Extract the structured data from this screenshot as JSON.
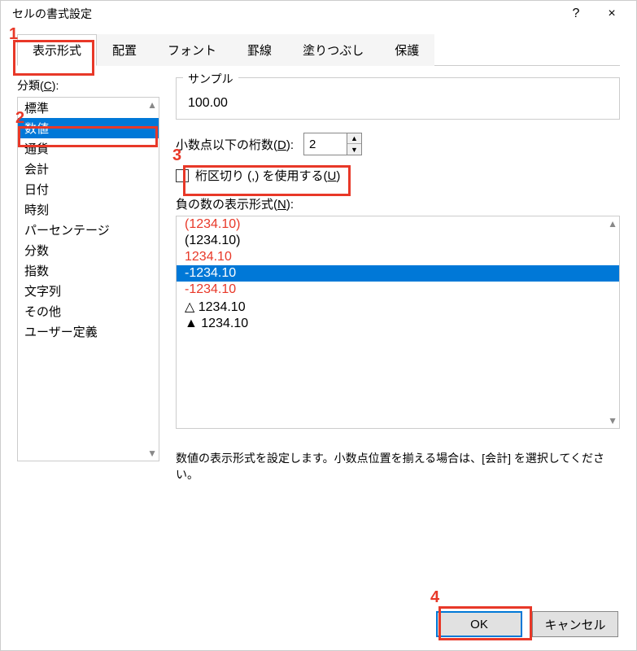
{
  "title": "セルの書式設定",
  "titlebar": {
    "help": "?",
    "close": "×"
  },
  "tabs": {
    "display": "表示形式",
    "align": "配置",
    "font": "フォント",
    "border": "罫線",
    "fill": "塗りつぶし",
    "protect": "保護"
  },
  "category_label_pre": "分類(",
  "category_label_u": "C",
  "category_label_post": "):",
  "categories": [
    "標準",
    "数値",
    "通貨",
    "会計",
    "日付",
    "時刻",
    "パーセンテージ",
    "分数",
    "指数",
    "文字列",
    "その他",
    "ユーザー定義"
  ],
  "sample_label": "サンプル",
  "sample_value": "100.00",
  "decimal_label_pre": "小数点以下の桁数(",
  "decimal_label_u": "D",
  "decimal_label_post": "):",
  "decimal_value": "2",
  "thousands_label_pre": "桁区切り (,) を使用する(",
  "thousands_label_u": "U",
  "thousands_label_post": ")",
  "neg_label_pre": "負の数の表示形式(",
  "neg_label_u": "N",
  "neg_label_post": "):",
  "neg_items": {
    "a": "(1234.10)",
    "b": "(1234.10)",
    "c": "1234.10",
    "d": "-1234.10",
    "e": "-1234.10",
    "f": "△ 1234.10",
    "g": "▲ 1234.10"
  },
  "description": "数値の表示形式を設定します。小数点位置を揃える場合は、[会計] を選択してください。",
  "buttons": {
    "ok": "OK",
    "cancel": "キャンセル"
  },
  "annotations": {
    "n1": "1",
    "n2": "2",
    "n3": "3",
    "n4": "4"
  }
}
